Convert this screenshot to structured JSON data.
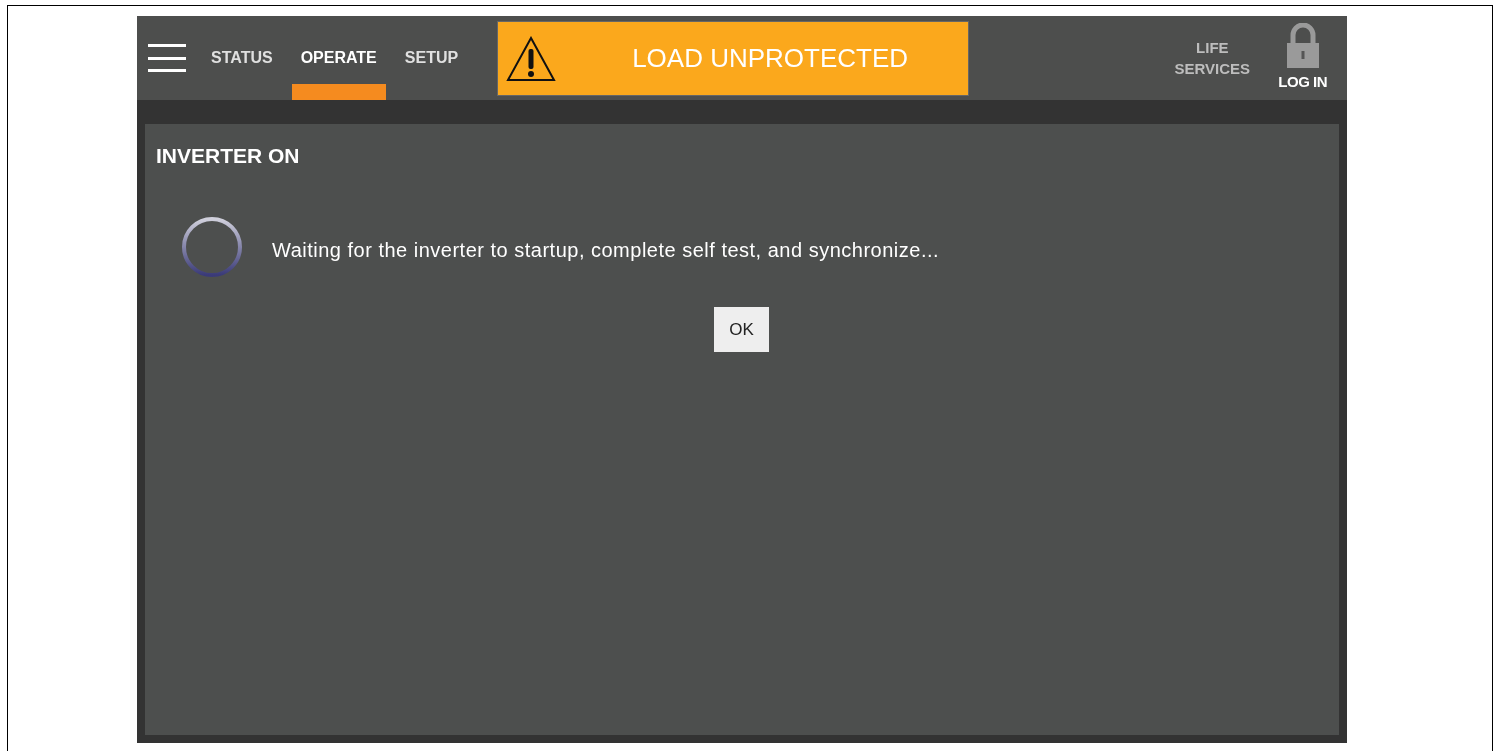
{
  "nav": {
    "tabs": [
      {
        "label": "STATUS",
        "selected": false
      },
      {
        "label": "OPERATE",
        "selected": true
      },
      {
        "label": "SETUP",
        "selected": false
      }
    ]
  },
  "alert": {
    "text": "LOAD UNPROTECTED"
  },
  "header_actions": [
    {
      "label": "LIFE SERVICES",
      "kind": "text"
    },
    {
      "label": "LOG IN",
      "kind": "lock"
    }
  ],
  "panel": {
    "title": "INVERTER ON",
    "message": "Waiting for the inverter to startup, complete self test, and synchronize...",
    "button": "OK"
  }
}
